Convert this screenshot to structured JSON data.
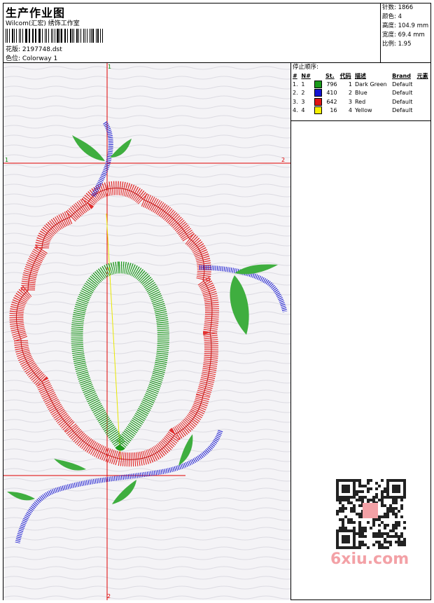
{
  "header": {
    "title": "生产作业图",
    "company": "Wilcom(汇宏) 绣饰工作室",
    "design_label": "花版: 2197748.dst",
    "colorway_label": "色位: Colorway 1"
  },
  "specs": [
    "针数: 1866",
    "颜色: 4",
    "高度: 104.9 mm",
    "宽度: 69.4 mm",
    "比例: 1.95"
  ],
  "stop_sequence": {
    "title": "停止顺序:",
    "columns": [
      "#",
      "N#",
      "St.",
      "代码",
      "描述",
      "Brand",
      "元素"
    ],
    "rows": [
      {
        "idx": "1.",
        "n": "1",
        "color": "#1a9a1a",
        "st": "796",
        "code": "1",
        "desc": "Dark Green",
        "brand": "Default"
      },
      {
        "idx": "2.",
        "n": "2",
        "color": "#1414d2",
        "st": "410",
        "code": "2",
        "desc": "Blue",
        "brand": "Default"
      },
      {
        "idx": "3.",
        "n": "3",
        "color": "#e01414",
        "st": "642",
        "code": "3",
        "desc": "Red",
        "brand": "Default"
      },
      {
        "idx": "4.",
        "n": "4",
        "color": "#f5f000",
        "st": "16",
        "code": "4",
        "desc": "Yellow",
        "brand": "Default"
      }
    ]
  },
  "guides": {
    "h_left": "1",
    "h_right": "2",
    "v_top": "1",
    "v_bottom": "2"
  },
  "watermark": "6xiu.com"
}
